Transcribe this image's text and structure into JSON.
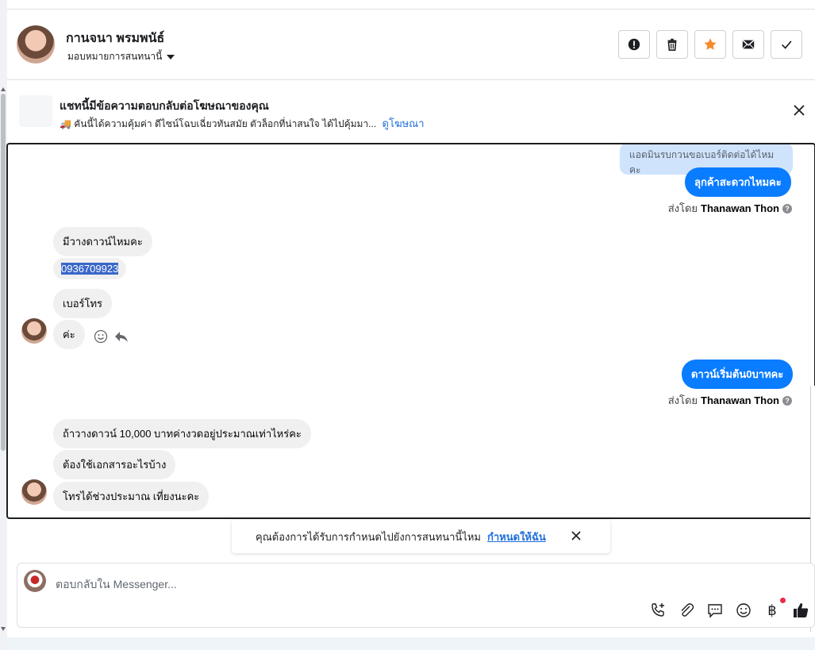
{
  "header": {
    "name": "กานจนา พรมพนัธ์",
    "assign_label": "มอบหมายการสนทนานี้",
    "actions": [
      "spam-icon",
      "trash-icon",
      "star-icon",
      "mail-icon",
      "check-icon"
    ],
    "accent_color": "#f5892b"
  },
  "ad_banner": {
    "title": "แชทนี้มีข้อความตอบกลับต่อโฆษณาของคุณ",
    "desc": "🚚 คันนี้ได้ความคุ้มค่า ดีไซน์โฉบเฉี่ยวทันสมัย ตัวล็อกที่น่าสนใจ ได้ไปคุ้มมา...",
    "link": "ดูโฆษณา"
  },
  "messages": {
    "quoted": "แอดมินรบกวนขอเบอร์ติดต่อได้ไหมคะ",
    "out1": "ลุกค้าสะดวกไหมคะ",
    "sent_by_1": "ส่งโดย",
    "sent_by_1_name": "Thanawan Thon",
    "in1": "มีวางดาวน์ไหมคะ",
    "in2": "0936709923",
    "in3": "เบอร์โทร",
    "in4": "ค่ะ",
    "out2": "ดาวน์เริ่มต้น0บาทคะ",
    "sent_by_2": "ส่งโดย",
    "sent_by_2_name": "Thanawan Thon",
    "in5": "ถ้าวางดาวน์ 10,000 บาทค่างวดอยู่ประมาณเท่าไหร่คะ",
    "in6": "ต้องใช้เอกสารอะไรบ้าง",
    "in7": "โทรได้ช่วงประมาณ เที่ยงนะคะ",
    "help_glyph": "?"
  },
  "notice": {
    "text": "คุณต้องการได้รับการกำหนดไปยังการสนทนานี้ไหม",
    "link": "กำหนดให้ฉัน"
  },
  "composer": {
    "placeholder": "ตอบกลับใน Messenger...",
    "tools": [
      "call-add-icon",
      "attach-icon",
      "saved-reply-icon",
      "emoji-icon",
      "baht-icon",
      "like-icon"
    ],
    "baht_glyph": "฿"
  },
  "colors": {
    "outgoing_bubble": "#0a7cff",
    "incoming_bubble": "#f0f0f0",
    "link": "#216fdb",
    "quoted_bg": "#cfe3fd"
  }
}
